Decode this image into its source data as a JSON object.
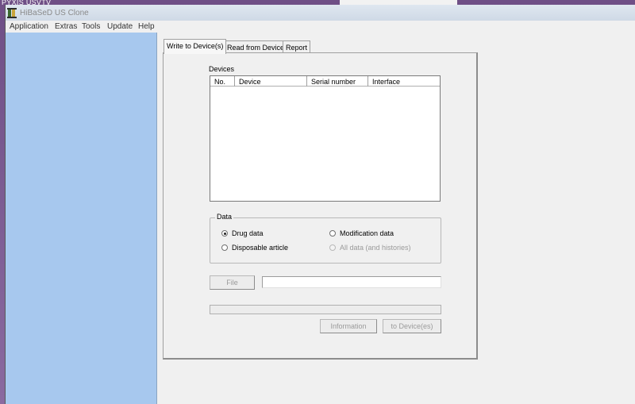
{
  "desktop": {
    "label": "PYXIS USVTV"
  },
  "window": {
    "title": "HiBaSeD  US  Clone"
  },
  "menu": [
    "Application",
    "Extras",
    "Tools",
    "Update",
    "Help"
  ],
  "tabs": [
    "Write to Device(s)",
    "Read from Device",
    "Report"
  ],
  "devices": {
    "label": "Devices",
    "columns": [
      "No.",
      "Device",
      "Serial number",
      "Interface"
    ]
  },
  "data_group": {
    "title": "Data",
    "options": {
      "drug": "Drug data",
      "modification": "Modification data",
      "disposable": "Disposable article",
      "all": "All data (and histories)"
    }
  },
  "file_button": "File",
  "file_path": "",
  "progress": 0,
  "buttons": {
    "information": "Information",
    "to_devices": "to Device(es)"
  }
}
